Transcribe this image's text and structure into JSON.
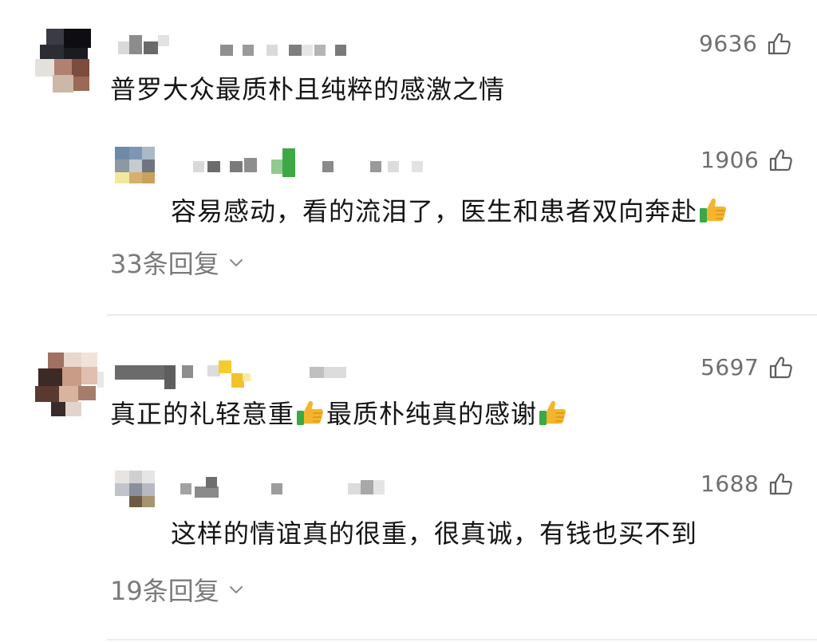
{
  "comments": [
    {
      "text": "普罗大众最质朴且纯粹的感激之情",
      "likes": "9636",
      "reply": {
        "text": "容易感动，看的流泪了，医生和患者双向奔赴",
        "likes": "1906"
      },
      "replies_label": "33条回复"
    },
    {
      "text_part1": "真正的礼轻意重",
      "text_part2": "最质朴纯真的感谢",
      "likes": "5697",
      "reply": {
        "text": "这样的情谊真的很重，很真诚，有钱也买不到",
        "likes": "1688"
      },
      "replies_label": "19条回复"
    }
  ],
  "icons": {
    "like": "thumbs-up-outline-icon",
    "thumb_emoji": "thumbs-up-emoji-icon",
    "expand": "chevron-down-icon"
  },
  "colors": {
    "text": "#151515",
    "muted": "#7a7a7a",
    "like_count": "#6f6f6f",
    "divider": "#ececec",
    "emoji_hand": "#f4b52e",
    "emoji_cuff": "#3aa844"
  }
}
